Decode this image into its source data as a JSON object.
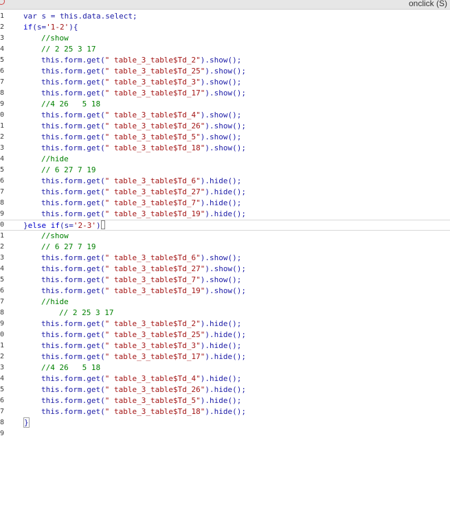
{
  "header": {
    "right_label": "onclick (S)"
  },
  "lines": [
    {
      "num": "1",
      "indent": 0,
      "tokens": [
        {
          "t": "var s = this.data.select;",
          "c": "plain"
        }
      ]
    },
    {
      "num": "2",
      "indent": 0,
      "tokens": [
        {
          "t": "if",
          "c": "kw"
        },
        {
          "t": "(s=",
          "c": "plain"
        },
        {
          "t": "'1-2'",
          "c": "str"
        },
        {
          "t": "){",
          "c": "plain"
        }
      ]
    },
    {
      "num": "3",
      "indent": 1,
      "tokens": [
        {
          "t": "//show",
          "c": "cm"
        }
      ]
    },
    {
      "num": "4",
      "indent": 1,
      "tokens": [
        {
          "t": "// 2 25 3 17",
          "c": "cm"
        }
      ]
    },
    {
      "num": "5",
      "indent": 1,
      "tokens": [
        {
          "t": "this.form.get(",
          "c": "plain"
        },
        {
          "t": "\" table_3_table$Td_2\"",
          "c": "str"
        },
        {
          "t": ").show();",
          "c": "plain"
        }
      ]
    },
    {
      "num": "6",
      "indent": 1,
      "tokens": [
        {
          "t": "this.form.get(",
          "c": "plain"
        },
        {
          "t": "\" table_3_table$Td_25\"",
          "c": "str"
        },
        {
          "t": ").show();",
          "c": "plain"
        }
      ]
    },
    {
      "num": "7",
      "indent": 1,
      "tokens": [
        {
          "t": "this.form.get(",
          "c": "plain"
        },
        {
          "t": "\" table_3_table$Td_3\"",
          "c": "str"
        },
        {
          "t": ").show();",
          "c": "plain"
        }
      ]
    },
    {
      "num": "8",
      "indent": 1,
      "tokens": [
        {
          "t": "this.form.get(",
          "c": "plain"
        },
        {
          "t": "\" table_3_table$Td_17\"",
          "c": "str"
        },
        {
          "t": ").show();",
          "c": "plain"
        }
      ]
    },
    {
      "num": "9",
      "indent": 1,
      "tokens": [
        {
          "t": "//4 26   5 18",
          "c": "cm"
        }
      ]
    },
    {
      "num": "0",
      "indent": 1,
      "tokens": [
        {
          "t": "this.form.get(",
          "c": "plain"
        },
        {
          "t": "\" table_3_table$Td_4\"",
          "c": "str"
        },
        {
          "t": ").show();",
          "c": "plain"
        }
      ]
    },
    {
      "num": "1",
      "indent": 1,
      "tokens": [
        {
          "t": "this.form.get(",
          "c": "plain"
        },
        {
          "t": "\" table_3_table$Td_26\"",
          "c": "str"
        },
        {
          "t": ").show();",
          "c": "plain"
        }
      ]
    },
    {
      "num": "2",
      "indent": 1,
      "tokens": [
        {
          "t": "this.form.get(",
          "c": "plain"
        },
        {
          "t": "\" table_3_table$Td_5\"",
          "c": "str"
        },
        {
          "t": ").show();",
          "c": "plain"
        }
      ]
    },
    {
      "num": "3",
      "indent": 1,
      "tokens": [
        {
          "t": "this.form.get(",
          "c": "plain"
        },
        {
          "t": "\" table_3_table$Td_18\"",
          "c": "str"
        },
        {
          "t": ").show();",
          "c": "plain"
        }
      ]
    },
    {
      "num": "4",
      "indent": 1,
      "tokens": [
        {
          "t": "//hide",
          "c": "cm"
        }
      ]
    },
    {
      "num": "5",
      "indent": 1,
      "tokens": [
        {
          "t": "// 6 27 7 19",
          "c": "cm"
        }
      ]
    },
    {
      "num": "6",
      "indent": 1,
      "tokens": [
        {
          "t": "this.form.get(",
          "c": "plain"
        },
        {
          "t": "\" table_3_table$Td_6\"",
          "c": "str"
        },
        {
          "t": ").hide();",
          "c": "plain"
        }
      ]
    },
    {
      "num": "7",
      "indent": 1,
      "tokens": [
        {
          "t": "this.form.get(",
          "c": "plain"
        },
        {
          "t": "\" table_3_table$Td_27\"",
          "c": "str"
        },
        {
          "t": ").hide();",
          "c": "plain"
        }
      ]
    },
    {
      "num": "8",
      "indent": 1,
      "tokens": [
        {
          "t": "this.form.get(",
          "c": "plain"
        },
        {
          "t": "\" table_3_table$Td_7\"",
          "c": "str"
        },
        {
          "t": ").hide();",
          "c": "plain"
        }
      ]
    },
    {
      "num": "9",
      "indent": 1,
      "tokens": [
        {
          "t": "this.form.get(",
          "c": "plain"
        },
        {
          "t": "\" table_3_table$Td_19\"",
          "c": "str"
        },
        {
          "t": ").hide();",
          "c": "plain"
        }
      ]
    },
    {
      "num": "0",
      "indent": 0,
      "current": true,
      "cursor": true,
      "tokens": [
        {
          "t": "}",
          "c": "plain"
        },
        {
          "t": "else if",
          "c": "kw"
        },
        {
          "t": "(s=",
          "c": "plain"
        },
        {
          "t": "'2-3'",
          "c": "str"
        },
        {
          "t": ")",
          "c": "plain"
        }
      ]
    },
    {
      "num": "1",
      "indent": 1,
      "tokens": [
        {
          "t": "//show",
          "c": "cm"
        }
      ]
    },
    {
      "num": "2",
      "indent": 1,
      "tokens": [
        {
          "t": "// 6 27 7 19",
          "c": "cm"
        }
      ]
    },
    {
      "num": "3",
      "indent": 1,
      "tokens": [
        {
          "t": "this.form.get(",
          "c": "plain"
        },
        {
          "t": "\" table_3_table$Td_6\"",
          "c": "str"
        },
        {
          "t": ").show();",
          "c": "plain"
        }
      ]
    },
    {
      "num": "4",
      "indent": 1,
      "tokens": [
        {
          "t": "this.form.get(",
          "c": "plain"
        },
        {
          "t": "\" table_3_table$Td_27\"",
          "c": "str"
        },
        {
          "t": ").show();",
          "c": "plain"
        }
      ]
    },
    {
      "num": "5",
      "indent": 1,
      "tokens": [
        {
          "t": "this.form.get(",
          "c": "plain"
        },
        {
          "t": "\" table_3_table$Td_7\"",
          "c": "str"
        },
        {
          "t": ").show();",
          "c": "plain"
        }
      ]
    },
    {
      "num": "6",
      "indent": 1,
      "tokens": [
        {
          "t": "this.form.get(",
          "c": "plain"
        },
        {
          "t": "\" table_3_table$Td_19\"",
          "c": "str"
        },
        {
          "t": ").show();",
          "c": "plain"
        }
      ]
    },
    {
      "num": "7",
      "indent": 1,
      "tokens": [
        {
          "t": "//hide",
          "c": "cm"
        }
      ]
    },
    {
      "num": "8",
      "indent": 2,
      "tokens": [
        {
          "t": "// 2 25 3 17",
          "c": "cm"
        }
      ]
    },
    {
      "num": "9",
      "indent": 1,
      "tokens": [
        {
          "t": "this.form.get(",
          "c": "plain"
        },
        {
          "t": "\" table_3_table$Td_2\"",
          "c": "str"
        },
        {
          "t": ").hide();",
          "c": "plain"
        }
      ]
    },
    {
      "num": "0",
      "indent": 1,
      "tokens": [
        {
          "t": "this.form.get(",
          "c": "plain"
        },
        {
          "t": "\" table_3_table$Td_25\"",
          "c": "str"
        },
        {
          "t": ").hide();",
          "c": "plain"
        }
      ]
    },
    {
      "num": "1",
      "indent": 1,
      "tokens": [
        {
          "t": "this.form.get(",
          "c": "plain"
        },
        {
          "t": "\" table_3_table$Td_3\"",
          "c": "str"
        },
        {
          "t": ").hide();",
          "c": "plain"
        }
      ]
    },
    {
      "num": "2",
      "indent": 1,
      "tokens": [
        {
          "t": "this.form.get(",
          "c": "plain"
        },
        {
          "t": "\" table_3_table$Td_17\"",
          "c": "str"
        },
        {
          "t": ").hide();",
          "c": "plain"
        }
      ]
    },
    {
      "num": "3",
      "indent": 1,
      "tokens": [
        {
          "t": "//4 26   5 18",
          "c": "cm"
        }
      ]
    },
    {
      "num": "4",
      "indent": 1,
      "tokens": [
        {
          "t": "this.form.get(",
          "c": "plain"
        },
        {
          "t": "\" table_3_table$Td_4\"",
          "c": "str"
        },
        {
          "t": ").hide();",
          "c": "plain"
        }
      ]
    },
    {
      "num": "5",
      "indent": 1,
      "tokens": [
        {
          "t": "this.form.get(",
          "c": "plain"
        },
        {
          "t": "\" table_3_table$Td_26\"",
          "c": "str"
        },
        {
          "t": ").hide();",
          "c": "plain"
        }
      ]
    },
    {
      "num": "6",
      "indent": 1,
      "tokens": [
        {
          "t": "this.form.get(",
          "c": "plain"
        },
        {
          "t": "\" table_3_table$Td_5\"",
          "c": "str"
        },
        {
          "t": ").hide();",
          "c": "plain"
        }
      ]
    },
    {
      "num": "7",
      "indent": 1,
      "tokens": [
        {
          "t": "this.form.get(",
          "c": "plain"
        },
        {
          "t": "\" table_3_table$Td_18\"",
          "c": "str"
        },
        {
          "t": ").hide();",
          "c": "plain"
        }
      ]
    },
    {
      "num": "8",
      "indent": 0,
      "bracket": true,
      "tokens": [
        {
          "t": "}",
          "c": "plain"
        }
      ]
    },
    {
      "num": "9",
      "indent": 0,
      "tokens": []
    }
  ],
  "colors": {
    "keyword": "#0000cc",
    "plain": "#1a1aa6",
    "comment": "#008000",
    "string": "#a31515"
  }
}
